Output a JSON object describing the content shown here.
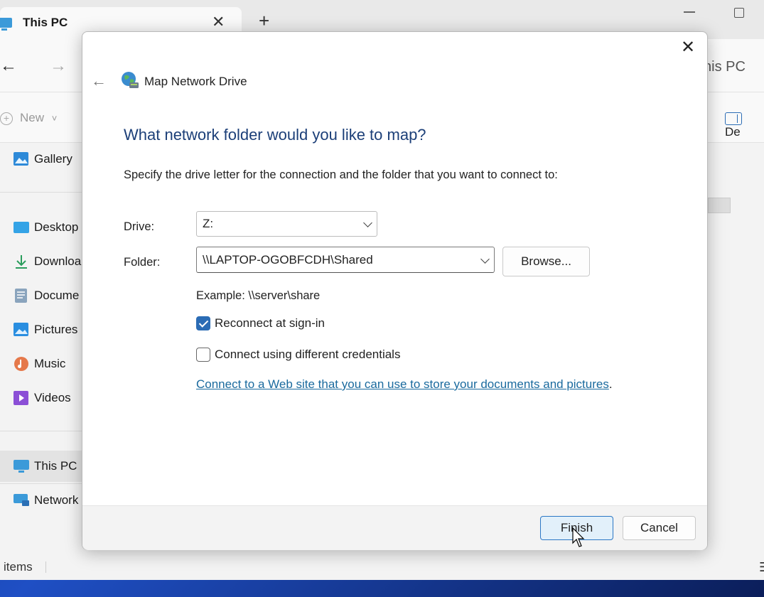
{
  "explorer": {
    "tab_title": "This PC",
    "tab_close": "✕",
    "tab_add": "+",
    "nav_back": "←",
    "nav_forward": "→",
    "address_partial": "his PC",
    "cmd_new": "New",
    "cmd_new_caret": "˅",
    "cmd_details": "De",
    "sidebar": {
      "gallery": "Gallery",
      "desktop": "Desktop",
      "downloads": "Downloa",
      "documents": "Docume",
      "pictures": "Pictures",
      "music": "Music",
      "videos": "Videos",
      "this_pc": "This PC",
      "network": "Network"
    },
    "status_items": "items",
    "status_view": "☰"
  },
  "dialog": {
    "close": "✕",
    "back": "←",
    "title": "Map Network Drive",
    "heading": "What network folder would you like to map?",
    "description": "Specify the drive letter for the connection and the folder that you want to connect to:",
    "drive_label": "Drive:",
    "drive_value": "Z:",
    "folder_label": "Folder:",
    "folder_value": "\\\\LAPTOP-OGOBFCDH\\Shared",
    "browse_label": "Browse...",
    "example": "Example: \\\\server\\share",
    "reconnect_label": "Reconnect at sign-in",
    "reconnect_checked": true,
    "credentials_label": "Connect using different credentials",
    "credentials_checked": false,
    "web_link": "Connect to a Web site that you can use to store your documents and pictures",
    "web_link_end": ".",
    "finish_label": "Finish",
    "cancel_label": "Cancel"
  },
  "colors": {
    "heading": "#1c3f78",
    "accent": "#2b6cb5",
    "link": "#1a6a9e"
  }
}
